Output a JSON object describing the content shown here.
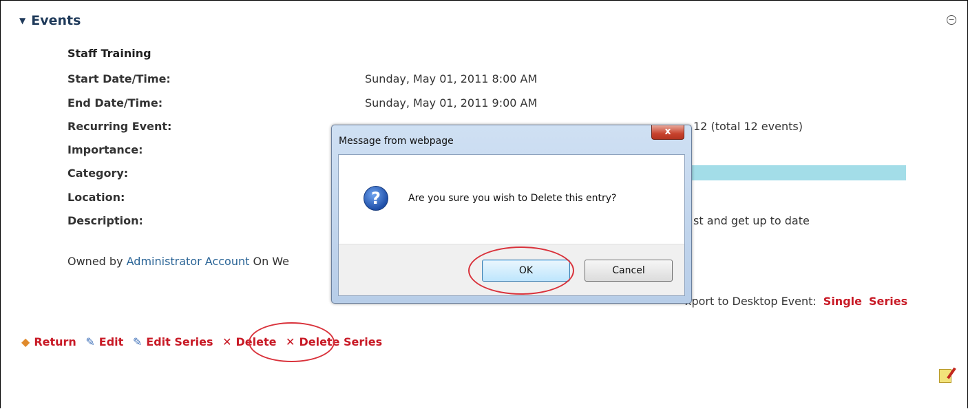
{
  "module": {
    "title": "Events"
  },
  "event": {
    "title": "Staff Training",
    "fields": [
      {
        "label": "Start Date/Time:",
        "value": "Sunday, May 01, 2011 8:00 AM"
      },
      {
        "label": "End Date/Time:",
        "value": "Sunday, May 01, 2011 9:00 AM"
      },
      {
        "label": "Recurring Event:",
        "value": "12 (total 12 events)"
      },
      {
        "label": "Importance:",
        "value": ""
      },
      {
        "label": "Category:",
        "value": ""
      },
      {
        "label": "Location:",
        "value": ""
      },
      {
        "label": "Description:",
        "value": "st and get up to date"
      }
    ],
    "owned_prefix": "Owned by ",
    "owner": "Administrator Account",
    "owned_suffix": " On We"
  },
  "export": {
    "label": "xport to Desktop Event:",
    "single": "Single",
    "series": "Series"
  },
  "actions": {
    "return": "Return",
    "edit": "Edit",
    "edit_series": "Edit Series",
    "delete": "Delete",
    "delete_series": "Delete Series"
  },
  "dialog": {
    "title": "Message from webpage",
    "close": "x",
    "message": "Are you sure you wish to Delete this entry?",
    "ok": "OK",
    "cancel": "Cancel"
  },
  "colors": {
    "accent": "#c81a26",
    "category_bar": "#a3dde8",
    "highlight": "#d9323b"
  }
}
